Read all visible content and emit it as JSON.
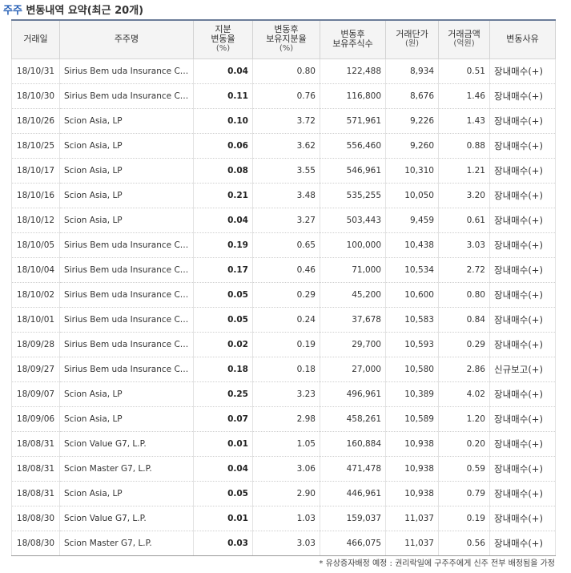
{
  "title": {
    "accent": "주주",
    "rest": " 변동내역 요약(최근 20개)"
  },
  "headers": {
    "date": "거래일",
    "holder": "주주명",
    "change_line1": "지분",
    "change_line2": "변동율",
    "change_unit": "(%)",
    "after_ratio_line1": "변동후",
    "after_ratio_line2": "보유지분율",
    "after_ratio_unit": "(%)",
    "after_shares_line1": "변동후",
    "after_shares_line2": "보유주식수",
    "price": "거래단가",
    "price_unit": "(원)",
    "amount": "거래금액",
    "amount_unit": "(억원)",
    "reason": "변동사유"
  },
  "rows": [
    {
      "date": "18/10/31",
      "holder": "Sirius Bem uda Insurance Company",
      "change": "0.04",
      "ratio": "0.80",
      "shares": "122,488",
      "price": "8,934",
      "amount": "0.51",
      "reason": "장내매수(+)"
    },
    {
      "date": "18/10/30",
      "holder": "Sirius Bem uda Insurance Company",
      "change": "0.11",
      "ratio": "0.76",
      "shares": "116,800",
      "price": "8,676",
      "amount": "1.46",
      "reason": "장내매수(+)"
    },
    {
      "date": "18/10/26",
      "holder": "Scion Asia, LP",
      "change": "0.10",
      "ratio": "3.72",
      "shares": "571,961",
      "price": "9,226",
      "amount": "1.43",
      "reason": "장내매수(+)"
    },
    {
      "date": "18/10/25",
      "holder": "Scion Asia, LP",
      "change": "0.06",
      "ratio": "3.62",
      "shares": "556,460",
      "price": "9,260",
      "amount": "0.88",
      "reason": "장내매수(+)"
    },
    {
      "date": "18/10/17",
      "holder": "Scion Asia, LP",
      "change": "0.08",
      "ratio": "3.55",
      "shares": "546,961",
      "price": "10,310",
      "amount": "1.21",
      "reason": "장내매수(+)"
    },
    {
      "date": "18/10/16",
      "holder": "Scion Asia, LP",
      "change": "0.21",
      "ratio": "3.48",
      "shares": "535,255",
      "price": "10,050",
      "amount": "3.20",
      "reason": "장내매수(+)"
    },
    {
      "date": "18/10/12",
      "holder": "Scion Asia, LP",
      "change": "0.04",
      "ratio": "3.27",
      "shares": "503,443",
      "price": "9,459",
      "amount": "0.61",
      "reason": "장내매수(+)"
    },
    {
      "date": "18/10/05",
      "holder": "Sirius Bem uda Insurance Company",
      "change": "0.19",
      "ratio": "0.65",
      "shares": "100,000",
      "price": "10,438",
      "amount": "3.03",
      "reason": "장내매수(+)"
    },
    {
      "date": "18/10/04",
      "holder": "Sirius Bem uda Insurance Company",
      "change": "0.17",
      "ratio": "0.46",
      "shares": "71,000",
      "price": "10,534",
      "amount": "2.72",
      "reason": "장내매수(+)"
    },
    {
      "date": "18/10/02",
      "holder": "Sirius Bem uda Insurance Company",
      "change": "0.05",
      "ratio": "0.29",
      "shares": "45,200",
      "price": "10,600",
      "amount": "0.80",
      "reason": "장내매수(+)"
    },
    {
      "date": "18/10/01",
      "holder": "Sirius Bem uda Insurance Company",
      "change": "0.05",
      "ratio": "0.24",
      "shares": "37,678",
      "price": "10,583",
      "amount": "0.84",
      "reason": "장내매수(+)"
    },
    {
      "date": "18/09/28",
      "holder": "Sirius Bem uda Insurance Company",
      "change": "0.02",
      "ratio": "0.19",
      "shares": "29,700",
      "price": "10,593",
      "amount": "0.29",
      "reason": "장내매수(+)"
    },
    {
      "date": "18/09/27",
      "holder": "Sirius Bem uda Insurance Company",
      "change": "0.18",
      "ratio": "0.18",
      "shares": "27,000",
      "price": "10,580",
      "amount": "2.86",
      "reason": "신규보고(+)"
    },
    {
      "date": "18/09/07",
      "holder": "Scion Asia, LP",
      "change": "0.25",
      "ratio": "3.23",
      "shares": "496,961",
      "price": "10,389",
      "amount": "4.02",
      "reason": "장내매수(+)"
    },
    {
      "date": "18/09/06",
      "holder": "Scion Asia, LP",
      "change": "0.07",
      "ratio": "2.98",
      "shares": "458,261",
      "price": "10,589",
      "amount": "1.20",
      "reason": "장내매수(+)"
    },
    {
      "date": "18/08/31",
      "holder": "Scion Value G7, L.P.",
      "change": "0.01",
      "ratio": "1.05",
      "shares": "160,884",
      "price": "10,938",
      "amount": "0.20",
      "reason": "장내매수(+)"
    },
    {
      "date": "18/08/31",
      "holder": "Scion Master G7, L.P.",
      "change": "0.04",
      "ratio": "3.06",
      "shares": "471,478",
      "price": "10,938",
      "amount": "0.59",
      "reason": "장내매수(+)"
    },
    {
      "date": "18/08/31",
      "holder": "Scion Asia, LP",
      "change": "0.05",
      "ratio": "2.90",
      "shares": "446,961",
      "price": "10,938",
      "amount": "0.79",
      "reason": "장내매수(+)"
    },
    {
      "date": "18/08/30",
      "holder": "Scion Value G7, L.P.",
      "change": "0.01",
      "ratio": "1.03",
      "shares": "159,037",
      "price": "11,037",
      "amount": "0.19",
      "reason": "장내매수(+)"
    },
    {
      "date": "18/08/30",
      "holder": "Scion Master G7, L.P.",
      "change": "0.03",
      "ratio": "3.03",
      "shares": "466,075",
      "price": "11,037",
      "amount": "0.56",
      "reason": "장내매수(+)"
    }
  ],
  "footnote": "* 유상증자배정 예정 : 권리락일에 구주주에게 신주 전부 배정됨을 가정",
  "colors": {
    "accent": "#2a62b7",
    "header_bg": "#f4f4f4",
    "header_border_top": "#6b7c99"
  }
}
